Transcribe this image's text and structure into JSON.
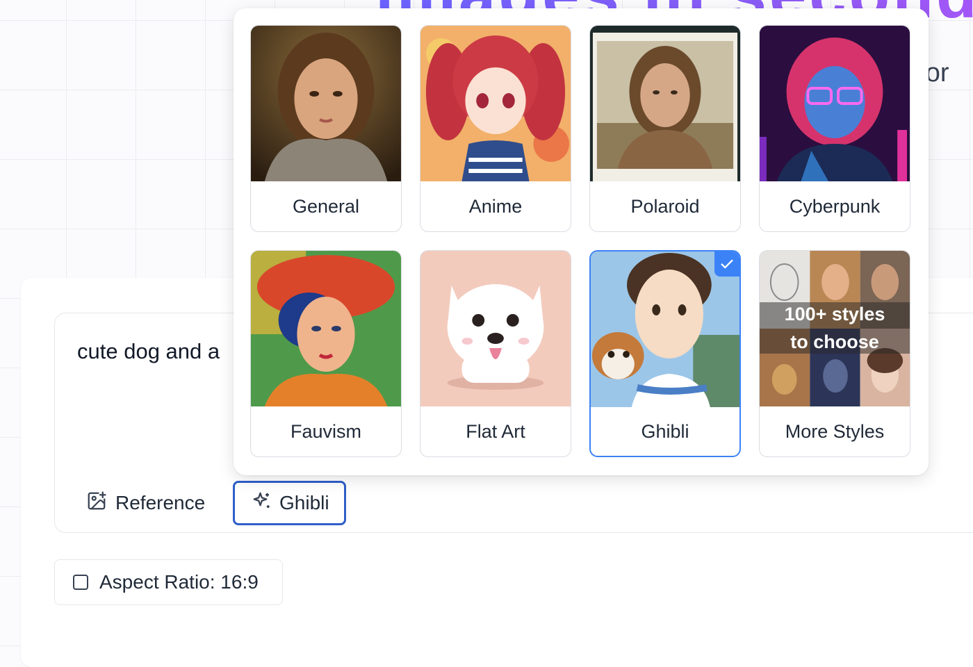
{
  "hero": {
    "title": "images in seconds",
    "subtitle": "ator"
  },
  "prompt": {
    "value": "cute dog and a"
  },
  "toolbar": {
    "reference_label": "Reference",
    "style_label": "Ghibli"
  },
  "aspect": {
    "label": "Aspect Ratio: 16:9",
    "checked": false
  },
  "styles": [
    {
      "label": "General",
      "selected": false
    },
    {
      "label": "Anime",
      "selected": false
    },
    {
      "label": "Polaroid",
      "selected": false
    },
    {
      "label": "Cyberpunk",
      "selected": false
    },
    {
      "label": "Fauvism",
      "selected": false
    },
    {
      "label": "Flat Art",
      "selected": false
    },
    {
      "label": "Ghibli",
      "selected": true
    },
    {
      "label": "More Styles",
      "selected": false
    }
  ],
  "more_styles_overlay": [
    "100+ styles",
    "to choose"
  ],
  "colors": {
    "accent": "#3b82f6",
    "selected_button_border": "#2f5ec8",
    "title_gradient": [
      "#6c63ff",
      "#a855f7"
    ]
  }
}
